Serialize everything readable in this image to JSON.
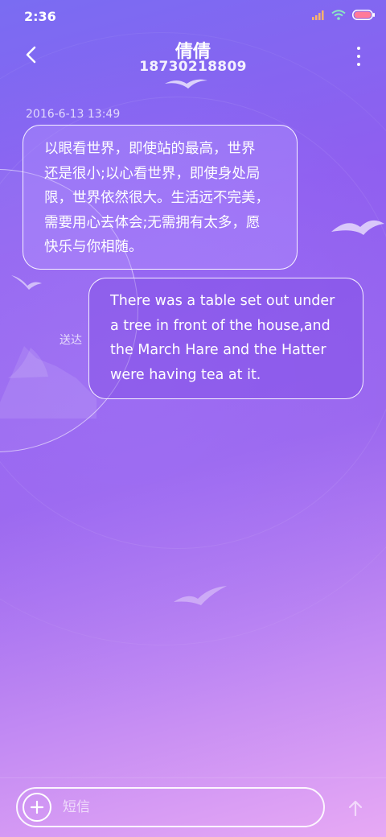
{
  "status_bar": {
    "time": "2:36",
    "icons": [
      "signal-icon",
      "wifi-icon",
      "battery-icon"
    ]
  },
  "header": {
    "title": "倩倩",
    "subtitle": "18730218809",
    "back_icon": "chevron-left-icon",
    "menu_icon": "more-vertical-icon"
  },
  "conversation": {
    "timestamp": "2016-6-13 13:49",
    "incoming": {
      "lines": [
        "以眼看世界，即使站的最高，世界",
        "还是很小;以心看世界，即使身处局",
        "限，世界依然很大。生活远不完美，",
        "需要用心去体会;无需拥有太多，愿",
        "快乐与你相随。"
      ]
    },
    "outgoing": {
      "lines": [
        "There was a table set out under",
        "a tree in front of the house,and",
        "the March Hare and the Hatter",
        "were having tea at it."
      ],
      "status": "送达"
    }
  },
  "composer": {
    "placeholder": "短信",
    "add_icon": "plus-circle-icon",
    "send_icon": "arrow-up-icon"
  },
  "colors": {
    "text": "#ffffff",
    "background_top": "#7a6cf2",
    "background_mid": "#9a66ee",
    "background_bottom": "#e7a9f4",
    "wifi": "#8be8c4",
    "battery": "#ff7a9a"
  }
}
